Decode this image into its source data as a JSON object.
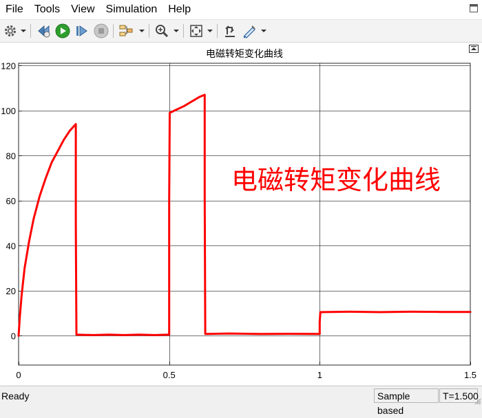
{
  "menu": {
    "items": [
      "File",
      "Tools",
      "View",
      "Simulation",
      "Help"
    ]
  },
  "toolbar": {
    "icons": [
      "gear-icon",
      "step-back-icon",
      "run-icon",
      "step-forward-icon",
      "stop-icon",
      "signal-selector-icon",
      "zoom-icon",
      "fit-to-view-icon",
      "cursor-measure-icon",
      "style-icon"
    ]
  },
  "colors": {
    "trace": "#ff0000",
    "run_button": "#2e9e2e",
    "grid": "#262626",
    "axes_background": "#ffffff"
  },
  "plot": {
    "title": "电磁转矩变化曲线",
    "annotation": "电磁转矩变化曲线"
  },
  "chart_data": {
    "type": "line",
    "title": "电磁转矩变化曲线",
    "xlabel": "",
    "ylabel": "",
    "xlim": [
      0,
      1.5
    ],
    "ylim": [
      -13,
      121
    ],
    "xticks": [
      0,
      0.5,
      1,
      1.5
    ],
    "xtick_labels": [
      "0",
      "0.5",
      "1",
      "1.5"
    ],
    "yticks": [
      0,
      20,
      40,
      60,
      80,
      100,
      120
    ],
    "ytick_labels": [
      "0",
      "20",
      "40",
      "60",
      "80",
      "100",
      "120"
    ],
    "grid": true,
    "annotation": "电磁转矩变化曲线",
    "series": [
      {
        "x": [
          0,
          0.004,
          0.01,
          0.02,
          0.035,
          0.05,
          0.07,
          0.09,
          0.11,
          0.13,
          0.15,
          0.17,
          0.19,
          0.19,
          0.192,
          0.25,
          0.3,
          0.35,
          0.4,
          0.45,
          0.5,
          0.5,
          0.502,
          0.55,
          0.6,
          0.618,
          0.618,
          0.62,
          0.7,
          0.8,
          0.9,
          1.0,
          1.0,
          1.002,
          1.1,
          1.2,
          1.3,
          1.4,
          1.5
        ],
        "values": [
          0,
          8,
          18,
          30,
          42,
          52,
          62,
          70,
          77,
          82,
          87,
          91,
          94,
          50,
          0.5,
          0.3,
          0.5,
          0.3,
          0.5,
          0.3,
          0.5,
          60,
          99,
          102,
          106,
          107,
          62,
          0.8,
          1.0,
          0.8,
          0.9,
          0.8,
          6,
          10.5,
          10.7,
          10.5,
          10.7,
          10.6,
          10.6
        ]
      }
    ]
  },
  "status": {
    "ready": "Ready",
    "sample_mode": "Sample based",
    "time": "T=1.500"
  }
}
